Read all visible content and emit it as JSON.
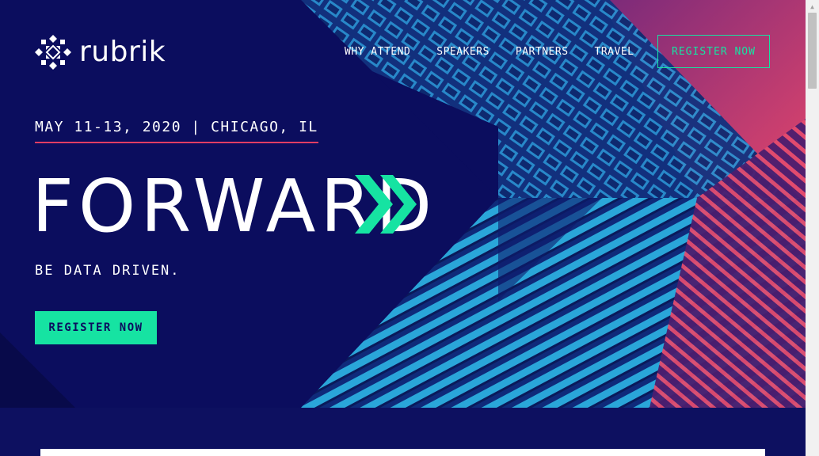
{
  "brand": {
    "name": "rubrik",
    "color": "#ffffff"
  },
  "nav": {
    "items": [
      {
        "label": "WHY ATTEND"
      },
      {
        "label": "SPEAKERS"
      },
      {
        "label": "PARTNERS"
      },
      {
        "label": "TRAVEL"
      }
    ],
    "register_label": "REGISTER NOW"
  },
  "hero": {
    "event_date": "MAY 11-13, 2020 | CHICAGO, IL",
    "headline": "FORWARD",
    "tagline": "BE DATA DRIVEN.",
    "register_label": "REGISTER NOW"
  },
  "colors": {
    "background": "#0b0d5e",
    "accent_green": "#16e3a2",
    "accent_pink": "#e23d63",
    "building_blue": "#1a7fc4"
  },
  "icons": {
    "logo": "rubrik-logo-icon",
    "chevrons": "double-chevron-right-icon",
    "scroll_up": "scroll-up-arrow-icon"
  }
}
